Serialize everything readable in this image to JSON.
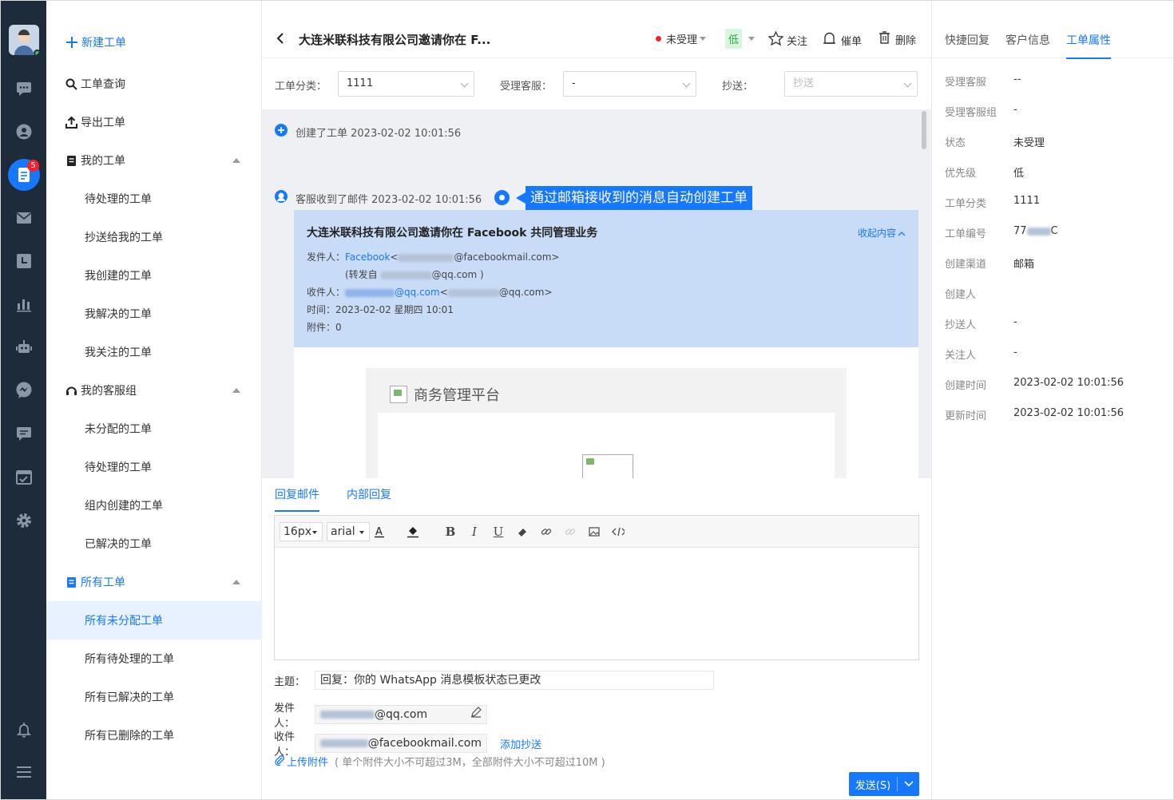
{
  "rail": {
    "badge": "5"
  },
  "nav": {
    "new_ticket": "新建工单",
    "query": "工单查询",
    "export": "导出工单",
    "my_tickets": "我的工单",
    "my_sub": [
      "待处理的工单",
      "抄送给我的工单",
      "我创建的工单",
      "我解决的工单",
      "我关注的工单"
    ],
    "my_group": "我的客服组",
    "group_sub": [
      "未分配的工单",
      "待处理的工单",
      "组内创建的工单",
      "已解决的工单"
    ],
    "all_tickets": "所有工单",
    "all_sub": [
      "所有未分配工单",
      "所有待处理的工单",
      "所有已解决的工单",
      "所有已删除的工单"
    ]
  },
  "header": {
    "title": "大连米联科技有限公司邀请你在 F...",
    "status": "未受理",
    "priority": "低",
    "follow": "关注",
    "urge": "催单",
    "delete": "删除"
  },
  "filters": {
    "category_label": "工单分类：",
    "category_value": "1111",
    "agent_label": "受理客服：",
    "agent_value": "-",
    "cc_label": "抄送：",
    "cc_placeholder": "抄送"
  },
  "thread": {
    "event1": "创建了工单 2023-02-02 10:01:56",
    "event2": "客服收到了邮件 2023-02-02 10:01:56",
    "annotation": "通过邮箱接收到的消息自动创建工单",
    "mail": {
      "subject": "大连米联科技有限公司邀请你在 Facebook 共同管理业务",
      "collapse": "收起内容",
      "from_label": "发件人：",
      "from_name": "Facebook",
      "from_domain": "@facebookmail.com>",
      "forward_prefix": "(转发自",
      "forward_domain": "@qq.com )",
      "to_label": "收件人：",
      "to_domain1": "@qq.com",
      "to_domain2": "@qq.com>",
      "time": "时间：2023-02-02 星期四 10:01",
      "attach": "附件：0",
      "platform_title": "商务管理平台"
    }
  },
  "reply": {
    "tab_mail": "回复邮件",
    "tab_internal": "内部回复",
    "font_size": "16px",
    "font_family": "arial",
    "subject_label": "主题：",
    "subject_value": "回复：你的 WhatsApp 消息模板状态已更改",
    "sender_label": "发件人：",
    "sender_domain": "@qq.com",
    "recipient_label": "收件人：",
    "recipient_domain": "@facebookmail.com",
    "add_cc": "添加抄送",
    "upload": "上传附件",
    "upload_hint": "( 单个附件大小不可超过3M，全部附件大小不可超过10M )",
    "send": "发送(S)"
  },
  "side": {
    "tabs": [
      "快捷回复",
      "客户信息",
      "工单属性"
    ],
    "props": [
      {
        "k": "受理客服",
        "v": "--"
      },
      {
        "k": "受理客服组",
        "v": "-"
      },
      {
        "k": "状态",
        "v": "未受理"
      },
      {
        "k": "优先级",
        "v": "低"
      },
      {
        "k": "工单分类",
        "v": "1111"
      },
      {
        "k": "工单编号",
        "v": "77"
      },
      {
        "k": "创建渠道",
        "v": "邮箱"
      },
      {
        "k": "创建人",
        "v": ""
      },
      {
        "k": "抄送人",
        "v": "-"
      },
      {
        "k": "关注人",
        "v": "-"
      },
      {
        "k": "创建时间",
        "v": "2023-02-02 10:01:56"
      },
      {
        "k": "更新时间",
        "v": "2023-02-02 10:01:56"
      }
    ],
    "ticket_no_suffix": "C"
  },
  "colors": {
    "accent": "#1677ff",
    "rail": "#1e2b3a",
    "badge": "#f5222d",
    "mail_header": "#c9dcf7"
  }
}
